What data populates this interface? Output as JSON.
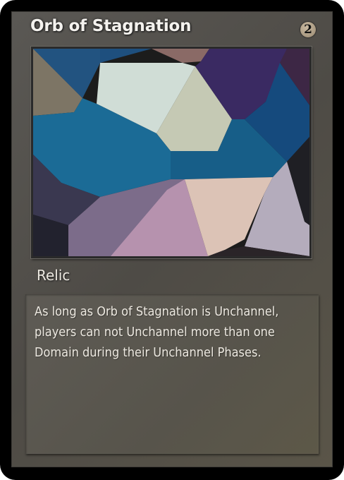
{
  "card": {
    "name": "Orb of Stagnation",
    "cost": "2",
    "type": "Relic",
    "rules_text": "As long as Orb of Stagnation is Unchannel, players can not Unchannel more than one Domain during their Unchannel Phases."
  },
  "art": {
    "description_icon": "abstract-polygon-art",
    "palette": [
      "#1e4f7e",
      "#d0ddd6",
      "#3b2760",
      "#124a7a",
      "#1b6b96",
      "#c5c9b4",
      "#7e7060",
      "#dcc3b6",
      "#b692ae",
      "#7c6c8a",
      "#3a3850",
      "#b4acbc",
      "#20202a",
      "#8a6a64",
      "#1c1c1c"
    ]
  }
}
